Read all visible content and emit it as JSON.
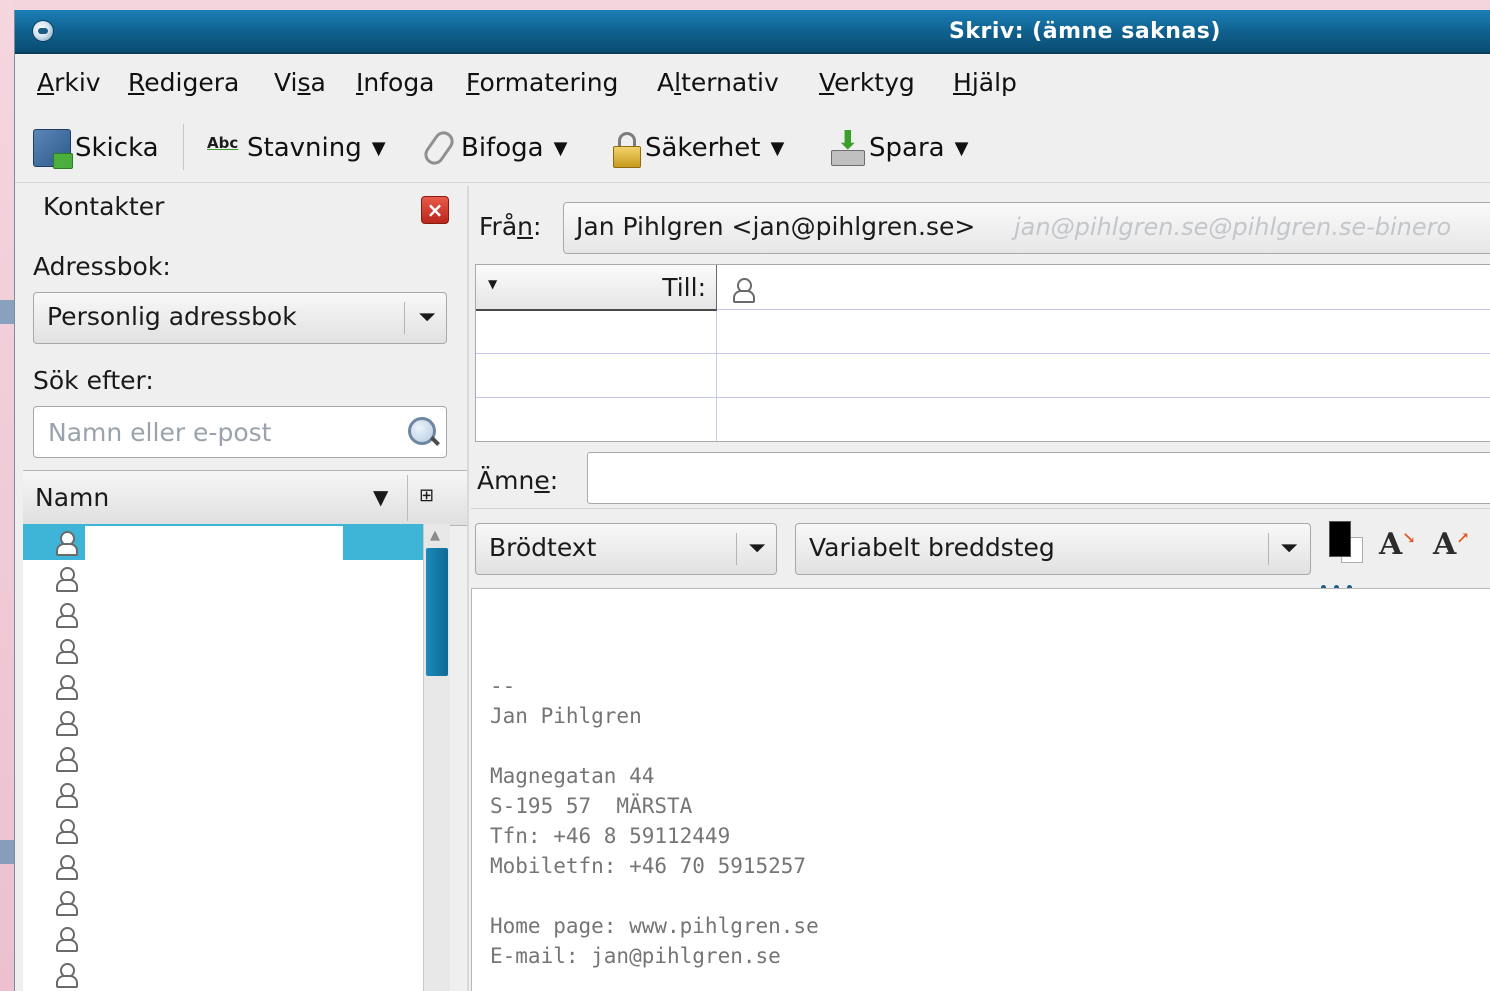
{
  "window": {
    "title": "Skriv: (ämne saknas)"
  },
  "menubar": {
    "items": [
      {
        "pre": "",
        "key": "A",
        "post": "rkiv"
      },
      {
        "pre": "",
        "key": "R",
        "post": "edigera"
      },
      {
        "pre": "Vi",
        "key": "s",
        "post": "a"
      },
      {
        "pre": "",
        "key": "I",
        "post": "nfoga"
      },
      {
        "pre": "",
        "key": "F",
        "post": "ormatering"
      },
      {
        "pre": "A",
        "key": "l",
        "post": "ternativ"
      },
      {
        "pre": "",
        "key": "V",
        "post": "erktyg"
      },
      {
        "pre": "",
        "key": "H",
        "post": "jälp"
      }
    ]
  },
  "toolbar": {
    "send": "Skicka",
    "spelling": "Stavning",
    "attach": "Bifoga",
    "security": "Säkerhet",
    "save": "Spara",
    "spell_icon_text": "Abc"
  },
  "sidebar": {
    "title": "Kontakter",
    "addressbook_label": "Adressbok:",
    "addressbook_value": "Personlig adressbok",
    "search_label": "Sök efter:",
    "search_placeholder": "Namn eller e-post",
    "column_name": "Namn",
    "contacts_visible": 13
  },
  "compose": {
    "from_label": "Från:",
    "from_value": "Jan Pihlgren <jan@pihlgren.se>",
    "from_hint": "jan@pihlgren.se@pihlgren.se-binero",
    "to_label": "Till:",
    "subject_label": "Ämne:",
    "subject_value": "",
    "paragraph_format": "Brödtext",
    "font": "Variabelt breddsteg",
    "text_color": "#000000",
    "background_color": "#ffffff",
    "signature": "--\nJan Pihlgren\n\nMagnegatan 44\nS-195 57  MÄRSTA\nTfn: +46 8 59112449\nMobiletfn: +46 70 5915257\n\nHome page: www.pihlgren.se\nE-mail: jan@pihlgren.se"
  },
  "icons": {
    "send": "send-icon",
    "spelling": "spellcheck-icon",
    "attach": "paperclip-icon",
    "security": "lock-icon",
    "save": "save-icon",
    "close": "close-icon",
    "search": "search-icon",
    "contact": "person-icon"
  },
  "colors": {
    "title_bar": "#0f5f8c",
    "selection": "#3eb5d6",
    "close_button": "#c8322a"
  }
}
